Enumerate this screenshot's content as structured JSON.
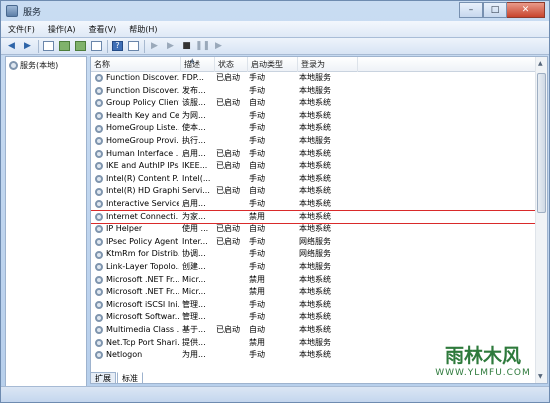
{
  "window": {
    "title": "服务"
  },
  "caption": {
    "min": "–",
    "max": "□",
    "close": "✕"
  },
  "menu": [
    "文件(F)",
    "操作(A)",
    "查看(V)",
    "帮助(H)"
  ],
  "tree": {
    "item": "服务(本地)"
  },
  "columns": {
    "name": "名称",
    "desc": "描述",
    "status": "状态",
    "startup": "启动类型",
    "logon": "登录为"
  },
  "rows": [
    {
      "name": "Function Discover...",
      "desc": "FDP...",
      "status": "已启动",
      "startup": "手动",
      "logon": "本地服务"
    },
    {
      "name": "Function Discover...",
      "desc": "发布...",
      "status": "",
      "startup": "手动",
      "logon": "本地服务"
    },
    {
      "name": "Group Policy Client",
      "desc": "该服...",
      "status": "已启动",
      "startup": "自动",
      "logon": "本地系统"
    },
    {
      "name": "Health Key and Ce...",
      "desc": "为网...",
      "status": "",
      "startup": "手动",
      "logon": "本地系统"
    },
    {
      "name": "HomeGroup Liste...",
      "desc": "使本...",
      "status": "",
      "startup": "手动",
      "logon": "本地系统"
    },
    {
      "name": "HomeGroup Provi...",
      "desc": "执行...",
      "status": "",
      "startup": "手动",
      "logon": "本地服务"
    },
    {
      "name": "Human Interface ...",
      "desc": "启用...",
      "status": "已启动",
      "startup": "手动",
      "logon": "本地系统"
    },
    {
      "name": "IKE and AuthIP IPs...",
      "desc": "IKEE...",
      "status": "已启动",
      "startup": "自动",
      "logon": "本地系统"
    },
    {
      "name": "Intel(R) Content P...",
      "desc": "Intel(...",
      "status": "",
      "startup": "手动",
      "logon": "本地系统"
    },
    {
      "name": "Intel(R) HD Graphi...",
      "desc": "Servi...",
      "status": "已启动",
      "startup": "自动",
      "logon": "本地系统"
    },
    {
      "name": "Interactive Service...",
      "desc": "启用...",
      "status": "",
      "startup": "手动",
      "logon": "本地系统"
    },
    {
      "name": "Internet Connecti...",
      "desc": "为家...",
      "status": "",
      "startup": "禁用",
      "logon": "本地系统"
    },
    {
      "name": "IP Helper",
      "desc": "使用 ...",
      "status": "已启动",
      "startup": "自动",
      "logon": "本地系统"
    },
    {
      "name": "IPsec Policy Agent",
      "desc": "Inter...",
      "status": "已启动",
      "startup": "手动",
      "logon": "网络服务"
    },
    {
      "name": "KtmRm for Distrib...",
      "desc": "协调...",
      "status": "",
      "startup": "手动",
      "logon": "网络服务"
    },
    {
      "name": "Link-Layer Topolo...",
      "desc": "创建...",
      "status": "",
      "startup": "手动",
      "logon": "本地服务"
    },
    {
      "name": "Microsoft .NET Fr...",
      "desc": "Micr...",
      "status": "",
      "startup": "禁用",
      "logon": "本地系统"
    },
    {
      "name": "Microsoft .NET Fr...",
      "desc": "Micr...",
      "status": "",
      "startup": "禁用",
      "logon": "本地系统"
    },
    {
      "name": "Microsoft iSCSI Ini...",
      "desc": "管理...",
      "status": "",
      "startup": "手动",
      "logon": "本地系统"
    },
    {
      "name": "Microsoft Softwar...",
      "desc": "管理...",
      "status": "",
      "startup": "手动",
      "logon": "本地系统"
    },
    {
      "name": "Multimedia Class ...",
      "desc": "基于...",
      "status": "已启动",
      "startup": "自动",
      "logon": "本地系统"
    },
    {
      "name": "Net.Tcp Port Shari...",
      "desc": "提供...",
      "status": "",
      "startup": "禁用",
      "logon": "本地服务"
    },
    {
      "name": "Netlogon",
      "desc": "为用...",
      "status": "",
      "startup": "手动",
      "logon": "本地系统"
    }
  ],
  "selected_row": 11,
  "tabs": [
    "扩展",
    "标准"
  ],
  "watermark": {
    "logo": "雨林木风",
    "url": "WWW.YLMFU.COM"
  }
}
